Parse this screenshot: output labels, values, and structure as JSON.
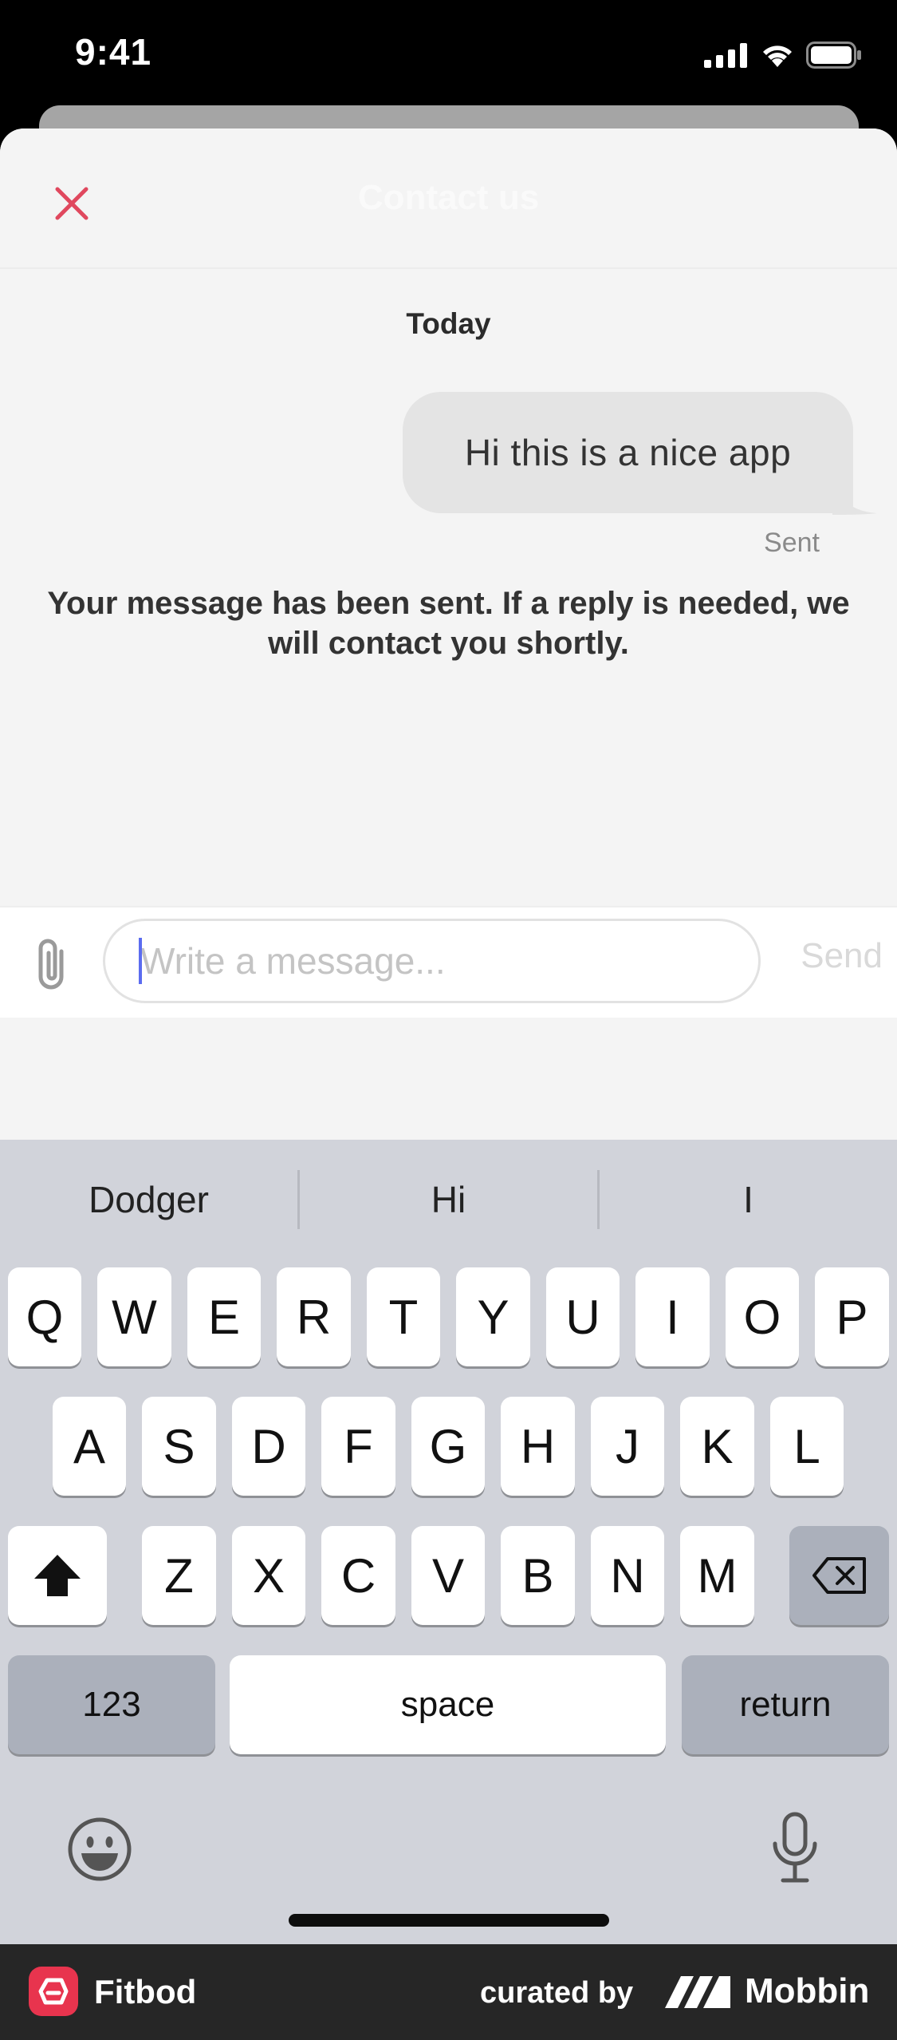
{
  "status_bar": {
    "time": "9:41"
  },
  "header": {
    "title": "Contact us"
  },
  "conversation": {
    "day_label": "Today",
    "message": "Hi this is a nice app",
    "message_status": "Sent",
    "confirmation": "Your message has been sent. If a reply is needed, we will contact you shortly."
  },
  "compose": {
    "placeholder": "Write a message...",
    "send_label": "Send"
  },
  "keyboard": {
    "suggestions": [
      "Dodger",
      "Hi",
      "I"
    ],
    "row1": [
      "Q",
      "W",
      "E",
      "R",
      "T",
      "Y",
      "U",
      "I",
      "O",
      "P"
    ],
    "row2": [
      "A",
      "S",
      "D",
      "F",
      "G",
      "H",
      "J",
      "K",
      "L"
    ],
    "row3": [
      "Z",
      "X",
      "C",
      "V",
      "B",
      "N",
      "M"
    ],
    "numbers_label": "123",
    "space_label": "space",
    "return_label": "return"
  },
  "footer": {
    "app_name": "Fitbod",
    "curated_label": "curated by",
    "brand": "Mobbin"
  },
  "colors": {
    "accent": "#e0485e",
    "bubble": "#e4e4e4",
    "keyboard_bg": "#d1d3da",
    "caret": "#5b6cf0"
  }
}
